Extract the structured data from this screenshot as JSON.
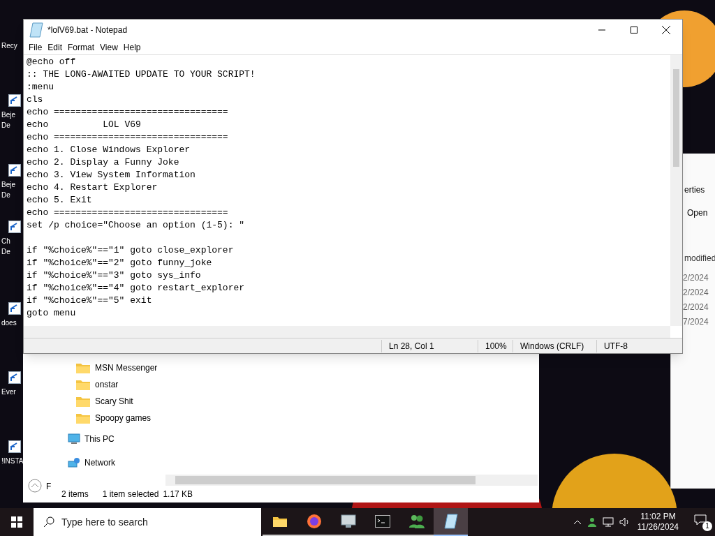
{
  "desktop_icons": [
    {
      "lines": [
        "Recy"
      ]
    },
    {
      "lines": [
        "Beje",
        "De"
      ]
    },
    {
      "lines": [
        "Beje",
        "De"
      ]
    },
    {
      "lines": [
        "Ch",
        "De"
      ]
    },
    {
      "lines": [
        "does"
      ]
    },
    {
      "lines": [
        "Ever"
      ]
    },
    {
      "lines": [
        "!INSTA"
      ]
    }
  ],
  "back_window": {
    "ribbon_label": "erties",
    "open_label": "Open",
    "column": "modified",
    "dates": [
      "2/2024",
      "2/2024",
      "2/2024",
      "7/2024"
    ]
  },
  "explorer": {
    "details_label": "F",
    "tree": [
      {
        "kind": "folder",
        "label": "MSN Messenger"
      },
      {
        "kind": "folder",
        "label": "onstar"
      },
      {
        "kind": "folder",
        "label": "Scary Shit"
      },
      {
        "kind": "folder",
        "label": "Spoopy games"
      },
      {
        "kind": "pc",
        "label": "This PC"
      },
      {
        "kind": "network",
        "label": "Network"
      }
    ],
    "status": [
      "2 items",
      "1 item selected",
      "1.17 KB"
    ]
  },
  "notepad": {
    "title": "*lolV69.bat - Notepad",
    "menu": [
      "File",
      "Edit",
      "Format",
      "View",
      "Help"
    ],
    "blocks": [
      [
        "@echo off",
        ":: THE LONG-AWAITED UPDATE TO YOUR SCRIPT!",
        ":menu",
        "cls",
        "echo ================================",
        "echo          LOL V69",
        "echo ================================",
        "echo 1. Close Windows Explorer",
        "echo 2. Display a Funny Joke",
        "echo 3. View System Information",
        "echo 4. Restart Explorer",
        "echo 5. Exit",
        "echo ================================",
        "set /p choice=\"Choose an option (1-5): \""
      ],
      [
        "if \"%choice%\"==\"1\" goto close_explorer",
        "if \"%choice%\"==\"2\" goto funny_joke",
        "if \"%choice%\"==\"3\" goto sys_info",
        "if \"%choice%\"==\"4\" goto restart_explorer",
        "if \"%choice%\"==\"5\" exit",
        "goto menu"
      ]
    ],
    "status": [
      "Ln 28, Col 1",
      "100%",
      "Windows (CRLF)",
      "UTF-8"
    ]
  },
  "taskbar": {
    "search_placeholder": "Type here to search",
    "apps": [
      {
        "kind": "folder",
        "selected": false
      },
      {
        "kind": "browser",
        "selected": false
      },
      {
        "kind": "monitor",
        "selected": false
      },
      {
        "kind": "terminal",
        "selected": false
      },
      {
        "kind": "people",
        "selected": false
      },
      {
        "kind": "notepad",
        "selected": true
      }
    ],
    "time": "11:02 PM",
    "date": "11/26/2024",
    "notifications": "1"
  }
}
